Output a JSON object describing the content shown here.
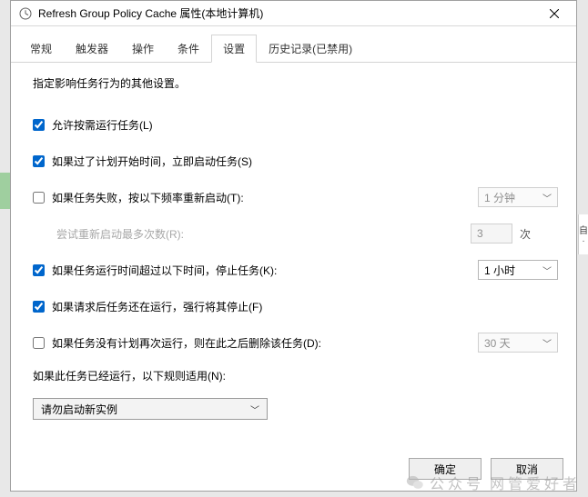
{
  "window": {
    "title": "Refresh Group Policy Cache 属性(本地计算机)"
  },
  "tabs": {
    "items": [
      {
        "label": "常规"
      },
      {
        "label": "触发器"
      },
      {
        "label": "操作"
      },
      {
        "label": "条件"
      },
      {
        "label": "设置",
        "active": true
      },
      {
        "label": "历史记录(已禁用)"
      }
    ]
  },
  "settings": {
    "description": "指定影响任务行为的其他设置。",
    "allow_on_demand": {
      "label": "允许按需运行任务(L)",
      "checked": true
    },
    "run_if_missed": {
      "label": "如果过了计划开始时间，立即启动任务(S)",
      "checked": true
    },
    "restart_on_fail": {
      "label": "如果任务失败，按以下频率重新启动(T):",
      "checked": false,
      "interval": "1 分钟",
      "retries_label": "尝试重新启动最多次数(R):",
      "retries_value": "3",
      "retries_suffix": "次"
    },
    "stop_if_longer": {
      "label": "如果任务运行时间超过以下时间，停止任务(K):",
      "checked": true,
      "value": "1 小时"
    },
    "force_stop": {
      "label": "如果请求后任务还在运行，强行将其停止(F)",
      "checked": true
    },
    "delete_if_not_scheduled": {
      "label": "如果任务没有计划再次运行，则在此之后删除该任务(D):",
      "checked": false,
      "value": "30 天"
    },
    "if_running_label": "如果此任务已经运行，以下规则适用(N):",
    "if_running_rule": "请勿启动新实例"
  },
  "buttons": {
    "ok": "确定",
    "cancel": "取消"
  },
  "watermark": {
    "prefix": "公众号",
    "name": "网管爱好者"
  },
  "side": {
    "char1": "自",
    "char2": "·"
  }
}
